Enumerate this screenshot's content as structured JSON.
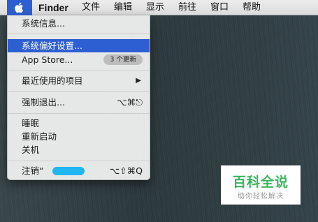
{
  "menubar": {
    "app_name": "Finder",
    "items": [
      "文件",
      "编辑",
      "显示",
      "前往",
      "窗口",
      "帮助"
    ]
  },
  "apple_menu": {
    "about": "系统信息...",
    "system_preferences": "系统偏好设置...",
    "app_store": "App Store...",
    "app_store_badge": "3 个更新",
    "recent_items": "最近使用的项目",
    "force_quit": "强制退出...",
    "force_quit_shortcut": "⌥⌘⎋",
    "sleep": "睡眠",
    "restart": "重新启动",
    "shutdown": "关机",
    "logout": "注销“",
    "logout_shortcut": "⌥⇧⌘Q"
  },
  "watermark": {
    "title": "百科全说",
    "subtitle": "助你轻松解决"
  },
  "colors": {
    "highlight": "#2d5fd2",
    "redaction": "#1fb6f2",
    "watermark_green": "#3ab55e"
  }
}
